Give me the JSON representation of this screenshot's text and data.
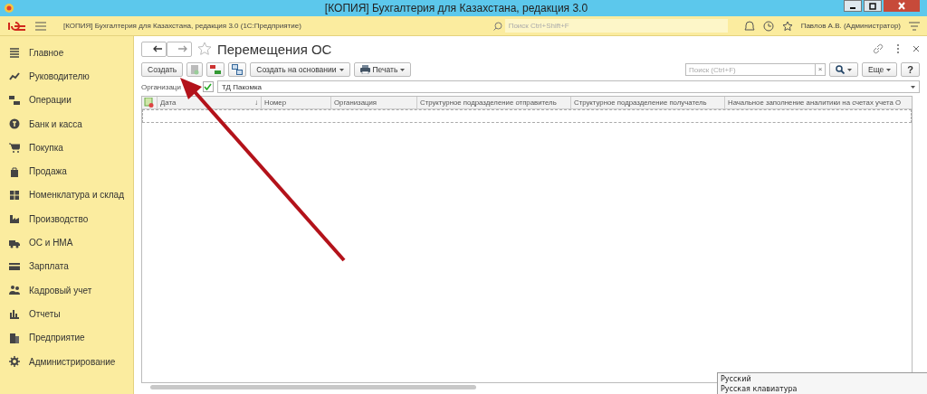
{
  "window": {
    "title": "[КОПИЯ] Бухгалтерия для Казахстана, редакция 3.0"
  },
  "app_bar": {
    "title": "[КОПИЯ] Бухгалтерия для Казахстана, редакция 3.0  (1С:Предприятие)",
    "search_placeholder": "Поиск Ctrl+Shift+F",
    "user": "Павлов А.В. (Администратор)"
  },
  "sidebar": {
    "items": [
      {
        "label": "Главное"
      },
      {
        "label": "Руководителю"
      },
      {
        "label": "Операции"
      },
      {
        "label": "Банк и касса"
      },
      {
        "label": "Покупка"
      },
      {
        "label": "Продажа"
      },
      {
        "label": "Номенклатура и склад"
      },
      {
        "label": "Производство"
      },
      {
        "label": "ОС и НМА"
      },
      {
        "label": "Зарплата"
      },
      {
        "label": "Кадровый учет"
      },
      {
        "label": "Отчеты"
      },
      {
        "label": "Предприятие"
      },
      {
        "label": "Администрирование"
      }
    ]
  },
  "form": {
    "title": "Перемещения ОС",
    "toolbar": {
      "create": "Создать",
      "create_based": "Создать на основании",
      "print": "Печать",
      "search_placeholder": "Поиск (Ctrl+F)",
      "clear": "×",
      "more": "Еще",
      "help": "?"
    },
    "filter": {
      "label": "Организаци",
      "checked": true,
      "value": "ТД Пакомка"
    },
    "table": {
      "columns": [
        {
          "label": "Дата",
          "sort": "↓"
        },
        {
          "label": "Номер"
        },
        {
          "label": "Организация"
        },
        {
          "label": "Структурное подразделение отправитель"
        },
        {
          "label": "Структурное подразделение получатель"
        },
        {
          "label": "Начальное заполнение аналитики на счетах учета О"
        }
      ]
    }
  },
  "language_tooltip": {
    "lines": [
      "Русский",
      "Русская клавиатура"
    ]
  }
}
